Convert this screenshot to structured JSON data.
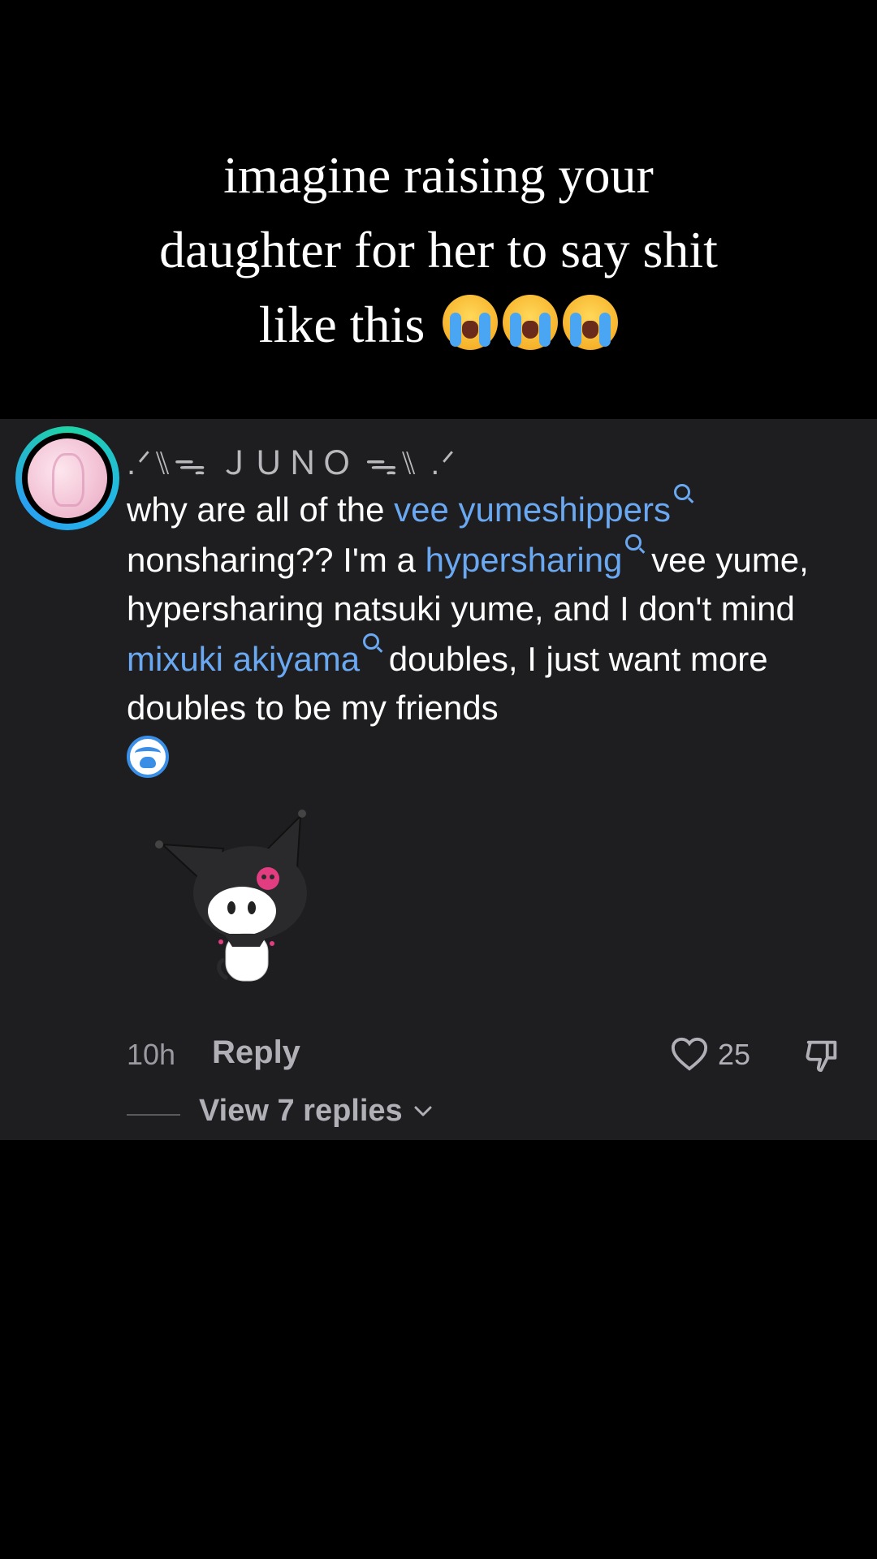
{
  "caption": {
    "line1": "imagine raising your",
    "line2": "daughter for her to say shit",
    "line3": "like this",
    "emoji": [
      "loudly-crying-face",
      "loudly-crying-face",
      "loudly-crying-face"
    ]
  },
  "comment": {
    "username": ".ᐟ⑊ᯓ ＪＵＮＯ ᯓ⑊ .ᐟ",
    "text_parts": {
      "p1": "why are all of the ",
      "link1": "vee yumeshippers",
      "p2": " nonsharing?? I'm a ",
      "link2": "hypersharing",
      "p3": " vee yume, hypersharing natsuki yume, and I don't mind ",
      "link3": "mixuki akiyama",
      "p4": " doubles, I just want more doubles to be my friends"
    },
    "time": "10h",
    "reply_label": "Reply",
    "like_count": "25",
    "view_replies": "View 7 replies"
  },
  "colors": {
    "background": "#000000",
    "card": "#1e1e20",
    "link": "#6aa8f2",
    "muted": "#b0b0b6"
  }
}
